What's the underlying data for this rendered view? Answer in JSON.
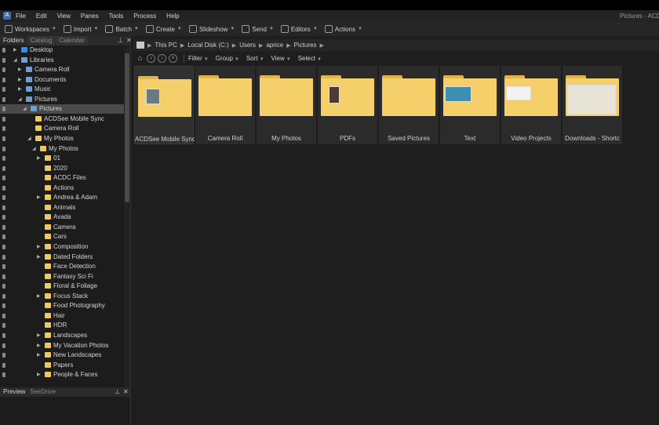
{
  "app": {
    "window_title": "Pictures - ACD"
  },
  "menu": [
    "File",
    "Edit",
    "View",
    "Panes",
    "Tools",
    "Process",
    "Help"
  ],
  "toolbar": [
    {
      "label": "Workspaces",
      "icon": "workspaces-icon"
    },
    {
      "label": "Import",
      "icon": "import-icon"
    },
    {
      "label": "Batch",
      "icon": "batch-icon"
    },
    {
      "label": "Create",
      "icon": "create-icon"
    },
    {
      "label": "Slideshow",
      "icon": "slideshow-icon"
    },
    {
      "label": "Send",
      "icon": "send-icon"
    },
    {
      "label": "Editors",
      "icon": "editors-icon"
    },
    {
      "label": "Actions",
      "icon": "actions-icon"
    }
  ],
  "left_panel": {
    "tabs": [
      "Folders",
      "Catalog",
      "Calendar"
    ],
    "tree": [
      {
        "label": "Desktop",
        "level": 0,
        "icon": "blue",
        "expand": "▶"
      },
      {
        "label": "Libraries",
        "level": 0,
        "icon": "lib",
        "expand": "◢"
      },
      {
        "label": "Camera Roll",
        "level": 1,
        "icon": "lib",
        "expand": "▶"
      },
      {
        "label": "Documents",
        "level": 1,
        "icon": "lib",
        "expand": "▶"
      },
      {
        "label": "Music",
        "level": 1,
        "icon": "lib",
        "expand": "▶"
      },
      {
        "label": "Pictures",
        "level": 1,
        "icon": "lib",
        "expand": "◢"
      },
      {
        "label": "Pictures",
        "level": 2,
        "icon": "lib",
        "expand": "◢",
        "selected": true
      },
      {
        "label": "ACDSee Mobile Sync",
        "level": 3,
        "icon": "folder",
        "expand": ""
      },
      {
        "label": "Camera Roll",
        "level": 3,
        "icon": "folder",
        "expand": ""
      },
      {
        "label": "My Photos",
        "level": 3,
        "icon": "folder",
        "expand": "◢"
      },
      {
        "label": "My Photos",
        "level": 4,
        "icon": "folder",
        "expand": "◢"
      },
      {
        "label": "01",
        "level": 5,
        "icon": "folder",
        "expand": "▶"
      },
      {
        "label": "2020",
        "level": 5,
        "icon": "folder",
        "expand": ""
      },
      {
        "label": "ACDC Files",
        "level": 5,
        "icon": "folder",
        "expand": ""
      },
      {
        "label": "Actions",
        "level": 5,
        "icon": "folder",
        "expand": ""
      },
      {
        "label": "Andrea & Adam",
        "level": 5,
        "icon": "folder",
        "expand": "▶"
      },
      {
        "label": "Animals",
        "level": 5,
        "icon": "folder",
        "expand": ""
      },
      {
        "label": "Avada",
        "level": 5,
        "icon": "folder",
        "expand": ""
      },
      {
        "label": "Camera",
        "level": 5,
        "icon": "folder",
        "expand": ""
      },
      {
        "label": "Cars",
        "level": 5,
        "icon": "folder",
        "expand": ""
      },
      {
        "label": "Composition",
        "level": 5,
        "icon": "folder",
        "expand": "▶"
      },
      {
        "label": "Dated Folders",
        "level": 5,
        "icon": "folder",
        "expand": "▶"
      },
      {
        "label": "Face Detection",
        "level": 5,
        "icon": "folder",
        "expand": ""
      },
      {
        "label": "Fantasy Sci Fi",
        "level": 5,
        "icon": "folder",
        "expand": ""
      },
      {
        "label": "Floral & Foliage",
        "level": 5,
        "icon": "folder",
        "expand": ""
      },
      {
        "label": "Focus Stack",
        "level": 5,
        "icon": "folder",
        "expand": "▶"
      },
      {
        "label": "Food Photography",
        "level": 5,
        "icon": "folder",
        "expand": ""
      },
      {
        "label": "Hair",
        "level": 5,
        "icon": "folder",
        "expand": ""
      },
      {
        "label": "HDR",
        "level": 5,
        "icon": "folder",
        "expand": ""
      },
      {
        "label": "Landscapes",
        "level": 5,
        "icon": "folder",
        "expand": "▶"
      },
      {
        "label": "My Vacation Photos",
        "level": 5,
        "icon": "folder",
        "expand": "▶"
      },
      {
        "label": "New Landscapes",
        "level": 5,
        "icon": "folder",
        "expand": "▶"
      },
      {
        "label": "Papers",
        "level": 5,
        "icon": "folder",
        "expand": ""
      },
      {
        "label": "People & Faces",
        "level": 5,
        "icon": "folder",
        "expand": "▶"
      }
    ],
    "bottom_tabs": [
      "Preview",
      "SeeDrive"
    ]
  },
  "address": [
    "This PC",
    "Local Disk (C:)",
    "Users",
    "aprice",
    "Pictures"
  ],
  "nav": {
    "menus": [
      "Filter",
      "Group",
      "Sort",
      "View",
      "Select"
    ]
  },
  "files": [
    {
      "name": "ACDSee Mobile Sync",
      "thumb": "photo-small"
    },
    {
      "name": "Camera Roll",
      "thumb": ""
    },
    {
      "name": "My Photos",
      "thumb": ""
    },
    {
      "name": "PDFs",
      "thumb": "portrait"
    },
    {
      "name": "Saved Pictures",
      "thumb": ""
    },
    {
      "name": "Text",
      "thumb": "landscape"
    },
    {
      "name": "Video Projects",
      "thumb": "doc"
    },
    {
      "name": "Downloads - Shortc",
      "thumb": "sketches"
    }
  ]
}
